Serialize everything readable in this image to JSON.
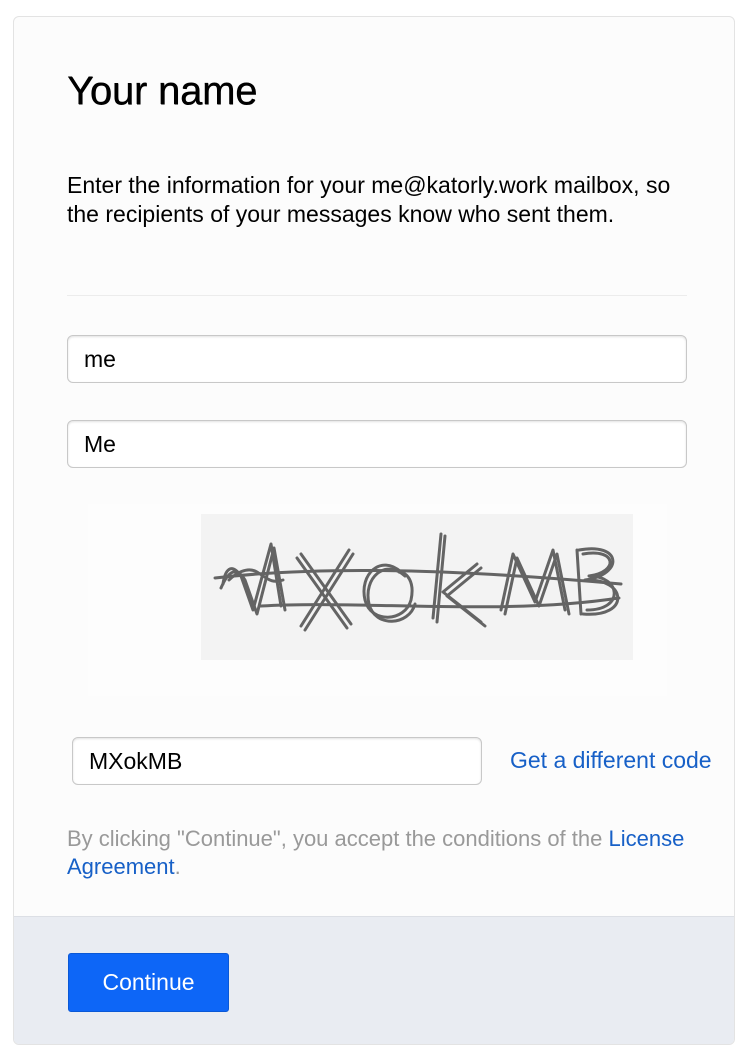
{
  "page": {
    "title": "Your name",
    "description": "Enter the information for your me@katorly.work mailbox, so the recipients of your messages know who sent them."
  },
  "form": {
    "first_name_value": "me",
    "last_name_value": "Me",
    "captcha_text": "MXokMB",
    "captcha_input_value": "MXokMB",
    "different_code_link": "Get a different code"
  },
  "legal": {
    "text": "By clicking \"Continue\", you accept the conditions of the ",
    "link": "License Agreement",
    "suffix": "."
  },
  "footer": {
    "continue_label": "Continue"
  },
  "colors": {
    "accent": "#0d66f7",
    "link": "#1760c7",
    "footer_bg": "#e9ecf2"
  }
}
